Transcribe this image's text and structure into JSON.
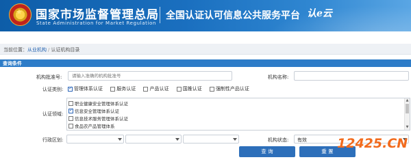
{
  "header": {
    "agency_cn": "国家市场监督管理总局",
    "agency_en": "State Administration  for  Market Regulation",
    "platform": "全国认证认可信息公共服务平台",
    "logo_text": "认e云"
  },
  "breadcrumb": {
    "prefix": "当前位置：",
    "items": [
      "从业机构",
      "认证机构目录"
    ],
    "separator": "/"
  },
  "query": {
    "panel_title": "查询条件",
    "approval_no_label": "机构批准号:",
    "approval_no_placeholder": "请输入准确的机构批准号",
    "name_label": "机构名称:",
    "name_value": "",
    "cert_type_label": "认证类别:",
    "cert_types": [
      {
        "label": "管理体系认证",
        "checked": true
      },
      {
        "label": "服务认证",
        "checked": false
      },
      {
        "label": "产品认证",
        "checked": false
      },
      {
        "label": "国推认证",
        "checked": false
      },
      {
        "label": "强制性产品认证",
        "checked": false
      }
    ],
    "field_label": "认证领域:",
    "fields": [
      {
        "label": "职业健康安全管理体系认证",
        "checked": false
      },
      {
        "label": "信息安全管理体系认证",
        "checked": true
      },
      {
        "label": "信息技术服务管理体系认证",
        "checked": false
      },
      {
        "label": "食品农产品管理体系",
        "checked": false
      }
    ],
    "region_label": "行政区划:",
    "region_values": [
      "",
      "",
      ""
    ],
    "status_label": "机构状态:",
    "status_value": "有效",
    "search_button": "查 询",
    "reset_button": "重 置"
  },
  "watermark": "12425.CN",
  "colors": {
    "banner": "#1a6fbf",
    "panel_header": "#2d7cc8",
    "button": "#2d6fba",
    "link": "#1f5fae",
    "watermark": "#f26b1d"
  }
}
